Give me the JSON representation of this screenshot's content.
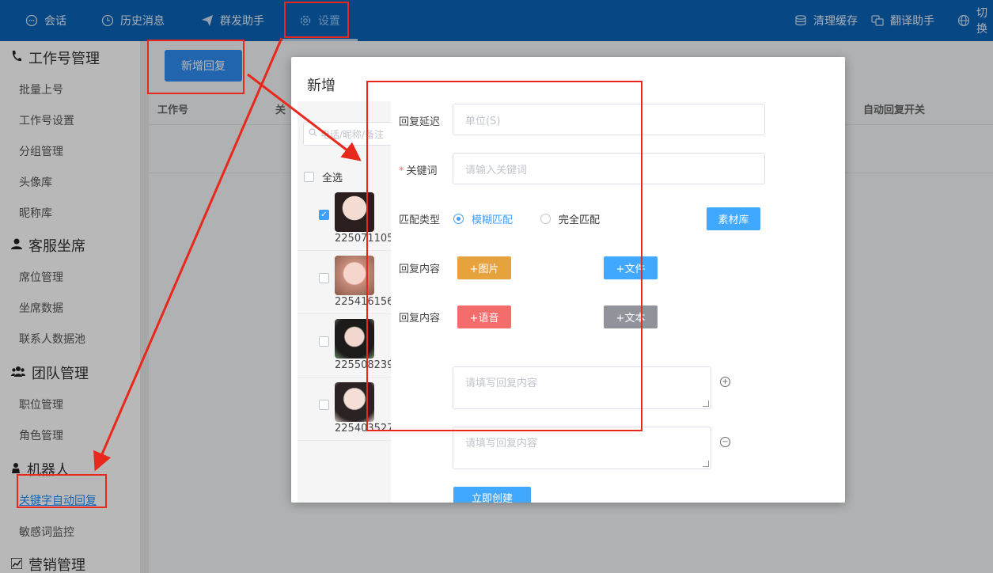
{
  "topbar": {
    "nav": [
      {
        "label": "会话",
        "icon": "chat-icon"
      },
      {
        "label": "历史消息",
        "icon": "clock-icon"
      },
      {
        "label": "群发助手",
        "icon": "send-icon"
      },
      {
        "label": "设置",
        "icon": "gear-icon"
      }
    ],
    "right": [
      {
        "label": "清理缓存",
        "icon": "database-icon"
      },
      {
        "label": "翻译助手",
        "icon": "translate-icon"
      },
      {
        "label": "切换",
        "icon": "globe-icon"
      }
    ]
  },
  "sidebar": {
    "groups": [
      {
        "title": "工作号管理",
        "icon": "phone-icon",
        "items": [
          "批量上号",
          "工作号设置",
          "分组管理",
          "头像库",
          "昵称库"
        ]
      },
      {
        "title": "客服坐席",
        "icon": "user-icon",
        "items": [
          "席位管理",
          "坐席数据",
          "联系人数据池"
        ]
      },
      {
        "title": "团队管理",
        "icon": "team-icon",
        "items": [
          "职位管理",
          "角色管理"
        ]
      },
      {
        "title": "机器人",
        "icon": "robot-icon",
        "items": [
          "关键字自动回复",
          "敏感词监控"
        ]
      },
      {
        "title": "营销管理",
        "icon": "chart-icon",
        "items": []
      }
    ],
    "active_item": "关键字自动回复"
  },
  "main": {
    "add_button": "新增回复",
    "columns": [
      "工作号",
      "关",
      "自动回复开关"
    ]
  },
  "dialog": {
    "title": "新增",
    "close": "×",
    "search_placeholder": "电话/昵称/备注",
    "check_all": "全选",
    "contacts": [
      {
        "id": "225071105",
        "checked": true
      },
      {
        "id": "225416156",
        "checked": false
      },
      {
        "id": "225508239",
        "checked": false
      },
      {
        "id": "225403527",
        "checked": false
      }
    ],
    "form": {
      "delay_label": "回复延迟",
      "delay_placeholder": "单位(S)",
      "keyword_label": "关键词",
      "keyword_placeholder": "请输入关键词",
      "match_label": "匹配类型",
      "match_fuzzy": "模糊匹配",
      "match_exact": "完全匹配",
      "library_button": "素材库",
      "content_label_1": "回复内容",
      "image_button": "+图片",
      "file_button": "+文件",
      "content_label_2": "回复内容",
      "voice_button": "+语音",
      "text_button": "+文本",
      "textarea_placeholder_1": "请填写回复内容",
      "textarea_placeholder_2": "请填写回复内容",
      "add_icon": "+",
      "remove_icon": "−",
      "submit_button": "立即创建"
    }
  },
  "colors": {
    "topbar": "#0b63b6",
    "primary": "#2d8cf0",
    "orange": "#e6a23c",
    "red": "#f56c6c",
    "gray": "#909399",
    "annotation": "#e8281c"
  }
}
